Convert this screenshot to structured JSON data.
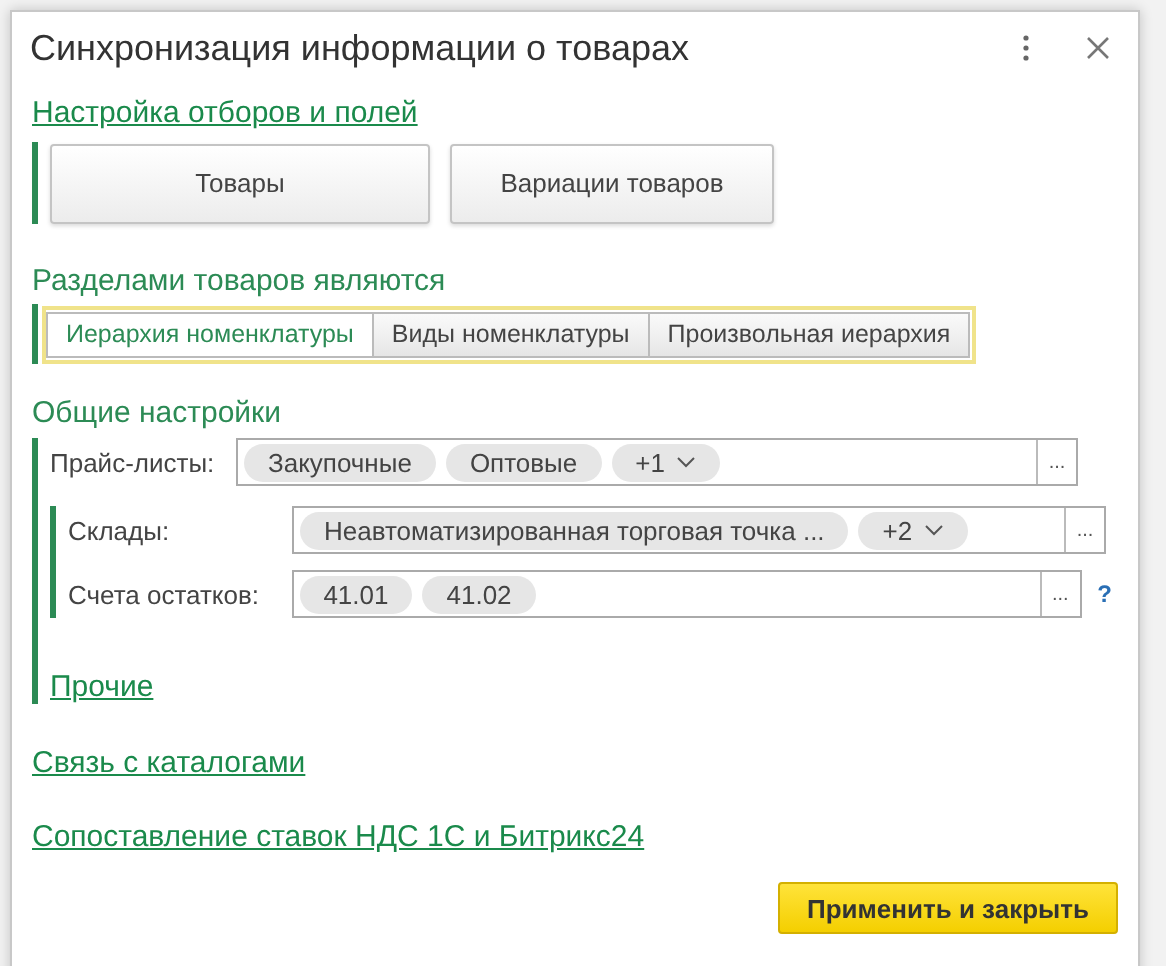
{
  "window": {
    "title": "Синхронизация информации о товарах"
  },
  "filters_link": "Настройка отборов и полей",
  "filter_buttons": [
    "Товары",
    "Вариации товаров"
  ],
  "sections_group": {
    "title": "Разделами товаров являются",
    "options": [
      {
        "label": "Иерархия номенклатуры",
        "selected": true
      },
      {
        "label": "Виды номенклатуры",
        "selected": false
      },
      {
        "label": "Произвольная иерархия",
        "selected": false
      }
    ]
  },
  "general": {
    "title": "Общие настройки",
    "price_lists": {
      "label": "Прайс-листы:",
      "tags": [
        "Закупочные",
        "Оптовые"
      ],
      "more": "+1",
      "select_button": "..."
    },
    "nested_fields": [
      {
        "label": "Склады:",
        "tags": [
          "Неавтоматизированная торговая точка ..."
        ],
        "more": "+2",
        "select_button": "..."
      },
      {
        "label": "Счета остатков:",
        "tags": [
          "41.01",
          "41.02"
        ],
        "select_button": "...",
        "help": "?"
      }
    ],
    "other_link": "Прочие"
  },
  "links": [
    "Связь с каталогами",
    "Сопоставление ставок НДС 1С и Битрикс24"
  ],
  "apply_button": "Применить и закрыть"
}
